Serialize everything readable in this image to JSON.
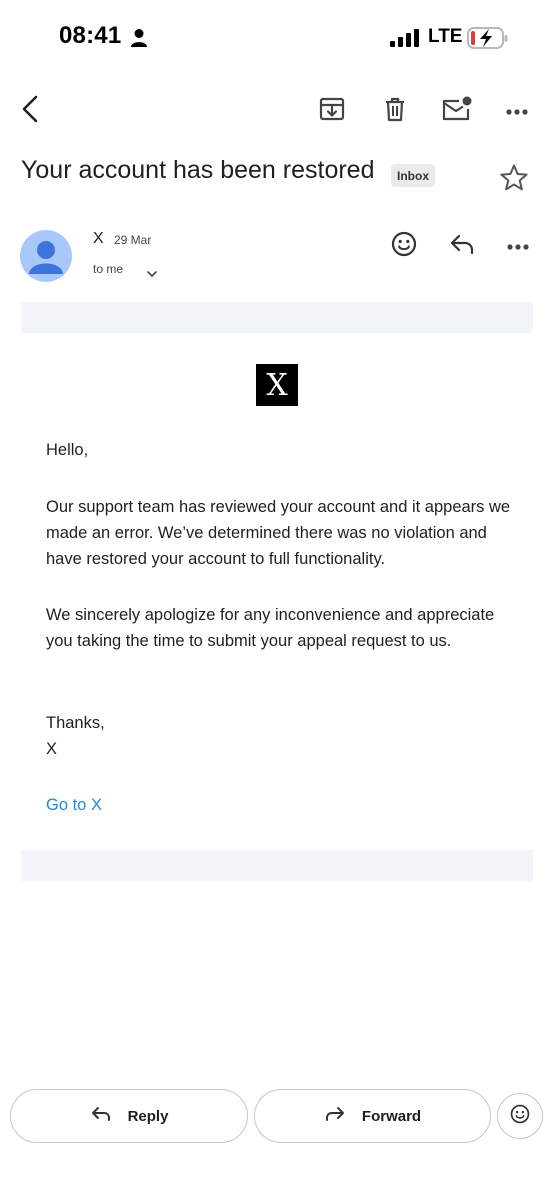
{
  "status_bar": {
    "time": "08:41",
    "network": "LTE"
  },
  "toolbar": {
    "back_icon": "arrow-left-icon",
    "archive_icon": "archive-icon",
    "delete_icon": "trash-icon",
    "mark_unread_icon": "mail-unread-icon",
    "more_icon": "more-horizontal-icon"
  },
  "email": {
    "subject": "Your account has been restored",
    "label": "Inbox",
    "sender": "X",
    "date": "29 Mar",
    "recipient": "to me",
    "logo_letter": "X",
    "body": {
      "greeting": "Hello,",
      "paragraph1": "Our support team has reviewed your account and it appears we made an error. We’ve determined there was no violation and have restored your account to full functionality.",
      "paragraph2": "We sincerely apologize for any inconvenience and appreciate you taking the time to submit your appeal request to us.",
      "signoff": "Thanks,",
      "signature": "X",
      "link": "Go to X"
    }
  },
  "actions": {
    "reply": "Reply",
    "forward": "Forward"
  },
  "colors": {
    "link": "#1a8cd8",
    "avatar_bg": "#a8c7fa",
    "avatar_fg": "#3f73dc",
    "band": "#f2f5f9"
  }
}
